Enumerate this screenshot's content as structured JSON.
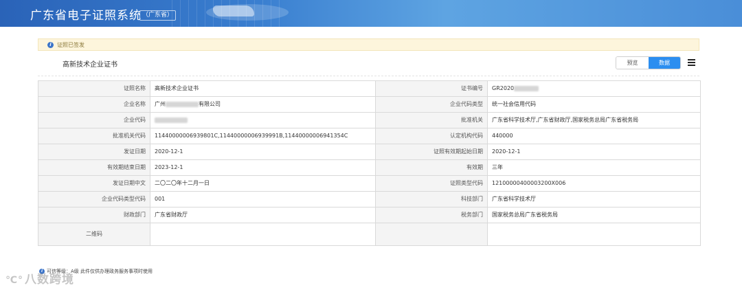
{
  "header": {
    "title": "广东省电子证照系统",
    "region": "（广东省）"
  },
  "notice": {
    "icon": "info-icon",
    "text": "证照已签发"
  },
  "certificate": {
    "title": "高新技术企业证书"
  },
  "view_toggle": {
    "preview_label": "预览",
    "data_label": "数据",
    "active": "数据",
    "active_color": "#2c8ef0"
  },
  "fields": {
    "cert_name_label": "证照名称",
    "cert_name_value": "高新技术企业证书",
    "cert_no_label": "证书编号",
    "cert_no_value": "GR2020",
    "company_name_label": "企业名称",
    "company_name_prefix": "广州",
    "company_name_suffix": "有限公司",
    "company_code_type_label": "企业代码类型",
    "company_code_type_value": "统一社会信用代码",
    "company_code_label": "企业代码",
    "company_code_value": "",
    "approval_org_label": "批准机关",
    "approval_org_value": "广东省科学技术厅,广东省财政厅,国家税务总局广东省税务局",
    "approval_org_code_label": "批准机关代码",
    "approval_org_code_value": "11440000006939801C,11440000006939991B,11440000006941354C",
    "accredit_org_code_label": "认定机构代码",
    "accredit_org_code_value": "440000",
    "issue_date_label": "发证日期",
    "issue_date_value": "2020-12-1",
    "valid_start_label": "证照有效期起始日期",
    "valid_start_value": "2020-12-1",
    "valid_end_label": "有效期结束日期",
    "valid_end_value": "2023-12-1",
    "valid_period_label": "有效期",
    "valid_period_value": "三年",
    "issue_date_cn_label": "发证日期中文",
    "issue_date_cn_value": "二〇二〇年十二月一日",
    "cert_type_code_label": "证照类型代码",
    "cert_type_code_value": "12100000400003200X006",
    "company_code_type_code_label": "企业代码类型代码",
    "company_code_type_code_value": "001",
    "tech_dept_label": "科技部门",
    "tech_dept_value": "广东省科学技术厅",
    "finance_dept_label": "财政部门",
    "finance_dept_value": "广东省财政厅",
    "tax_dept_label": "税务部门",
    "tax_dept_value": "国家税务总局广东省税务局",
    "qr_label": "二维码"
  },
  "footer": {
    "icon": "info-icon",
    "text": "可信等级：A级 此件仅供办理政务服务事项时使用"
  },
  "watermark": {
    "text": "八数跨境"
  },
  "colors": {
    "banner": "#3a7fd0",
    "notice_bg": "#fdf5dc",
    "label_bg": "#f4f4f4"
  }
}
